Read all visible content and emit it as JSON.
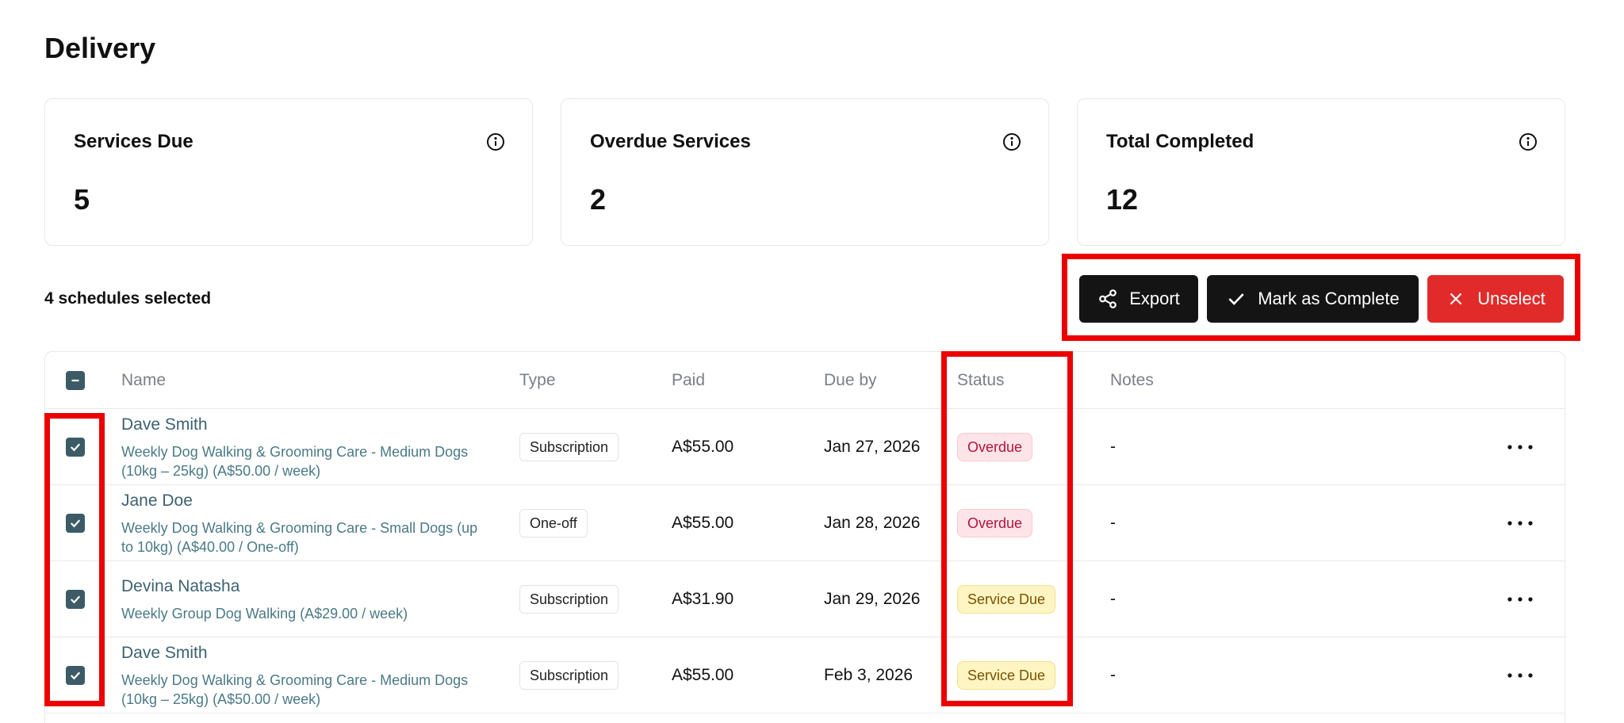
{
  "page": {
    "title": "Delivery"
  },
  "stats": [
    {
      "label": "Services Due",
      "value": "5"
    },
    {
      "label": "Overdue Services",
      "value": "2"
    },
    {
      "label": "Total Completed",
      "value": "12"
    }
  ],
  "selection": {
    "count_text": "4 schedules selected"
  },
  "actions": {
    "export": "Export",
    "complete": "Mark as Complete",
    "unselect": "Unselect"
  },
  "table": {
    "headers": {
      "name": "Name",
      "type": "Type",
      "paid": "Paid",
      "due": "Due by",
      "status": "Status",
      "notes": "Notes"
    },
    "rows": [
      {
        "name": "Dave Smith",
        "service": "Weekly Dog Walking & Grooming Care - Medium Dogs (10kg – 25kg) (A$50.00 / week)",
        "type": "Subscription",
        "paid": "A$55.00",
        "due": "Jan 27, 2026",
        "status": "Overdue",
        "notes": "-"
      },
      {
        "name": "Jane Doe",
        "service": "Weekly Dog Walking & Grooming Care - Small Dogs (up to 10kg) (A$40.00 / One-off)",
        "type": "One-off",
        "paid": "A$55.00",
        "due": "Jan 28, 2026",
        "status": "Overdue",
        "notes": "-"
      },
      {
        "name": "Devina Natasha",
        "service": "Weekly Group Dog Walking (A$29.00 / week)",
        "type": "Subscription",
        "paid": "A$31.90",
        "due": "Jan 29, 2026",
        "status": "Service Due",
        "notes": "-"
      },
      {
        "name": "Dave Smith",
        "service": "Weekly Dog Walking & Grooming Care - Medium Dogs (10kg – 25kg) (A$50.00 / week)",
        "type": "Subscription",
        "paid": "A$55.00",
        "due": "Feb 3, 2026",
        "status": "Service Due",
        "notes": "-"
      }
    ]
  },
  "icons": {
    "info": "info-circle-icon",
    "export": "share-icon",
    "complete": "checkmark-icon",
    "unselect": "x-close-icon",
    "more": "more-horizontal-icon",
    "checkbox": "checkbox-checked-icon",
    "indeterminate": "checkbox-indeterminate-icon"
  },
  "colors": {
    "primary_button": "#141414",
    "danger_button": "#e12b2b",
    "checkbox": "#3c5b66",
    "overdue_bg": "#fde4e8",
    "overdue_text": "#b0143d",
    "due_bg": "#fff5c2",
    "due_text": "#7a5200",
    "highlight": "#ec0000"
  }
}
